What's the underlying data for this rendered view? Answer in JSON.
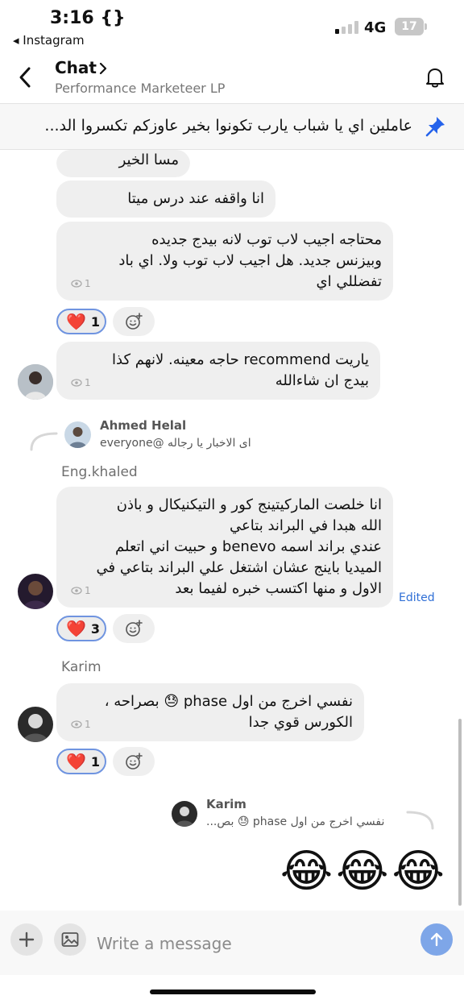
{
  "status_bar": {
    "time": "3:16 {}",
    "back_app": "◂ Instagram",
    "network": "4G",
    "battery": "17"
  },
  "header": {
    "title": "Chat",
    "subtitle": "Performance Marketeer LP"
  },
  "pinned": {
    "text": "عاملين اي يا شباب يارب تكونوا بخير عاوزكم تكسروا الد..."
  },
  "messages": [
    {
      "text": "مسا الخير"
    },
    {
      "text": "انا واقفه عند درس ميتا"
    },
    {
      "text": "محتاجه  اجيب لاب توب لانه بيدج جديده\nوبيزنس جديد. هل اجيب   لاب توب ولا. اي باد\nتفضللي اي",
      "seen": "1",
      "reaction_emoji": "❤️",
      "reaction_count": "1"
    },
    {
      "text": "ياريت recommend حاجه معينه. لانهم كذا\nبيدج ان شاءالله",
      "seen": "1"
    },
    {
      "reply": {
        "name": "Ahmed Helal",
        "text": "اى الاخبار يا رجاله @everyone"
      }
    },
    {
      "sender": "Eng.khaled",
      "text": "انا خلصت الماركيتينج كور و التيكنيكال و باذن\nالله هبدا في البراند بتاعي\nعندي براند اسمه benevo و حبيت اني اتعلم\nالميديا باينج عشان اشتغل علي البراند بتاعي في\nالاول و منها اكتسب خبره لفيما بعد",
      "seen": "1",
      "edited": "Edited",
      "reaction_emoji": "❤️",
      "reaction_count": "3"
    },
    {
      "sender": "Karim",
      "text": "نفسي اخرج من اول  phase 😓 بصراحه ،\nالكورس قوي جدا",
      "seen": "1",
      "reaction_emoji": "❤️",
      "reaction_count": "1"
    },
    {
      "reply": {
        "name": "Karim",
        "text": "نفسي اخرج من اول  phase 😓 بص..."
      }
    },
    {
      "text": "😂😂😂"
    }
  ],
  "composer": {
    "placeholder": "Write a message"
  },
  "colors": {
    "accent": "#7ea6e8",
    "bubble": "#efefef",
    "edited": "#2f6fd6"
  }
}
